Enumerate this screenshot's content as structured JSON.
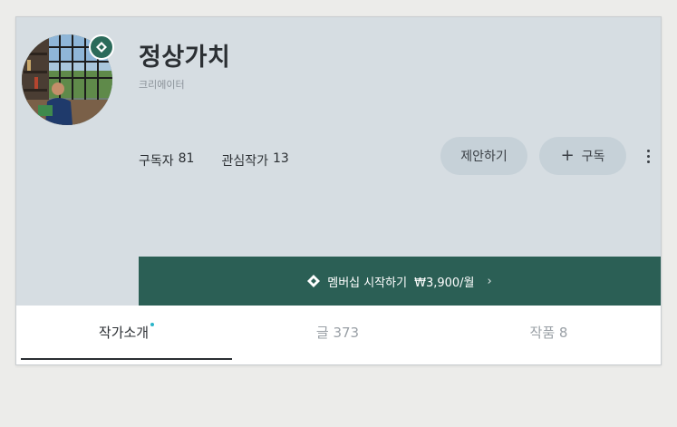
{
  "profile": {
    "name": "정상가치",
    "role": "크리에이터",
    "subscribers_label": "구독자",
    "subscribers_count": "81",
    "following_label": "관심작가",
    "following_count": "13"
  },
  "actions": {
    "propose_label": "제안하기",
    "subscribe_label": "구독",
    "more_icon": "more-vertical-icon"
  },
  "membership": {
    "label": "멤버십 시작하기",
    "price": "₩3,900/월",
    "chevron": "›"
  },
  "tabs": [
    {
      "label": "작가소개",
      "active": true
    },
    {
      "label": "글 373",
      "active": false
    },
    {
      "label": "작품 8",
      "active": false
    }
  ],
  "colors": {
    "header_bg": "#d6dde2",
    "membership_bg": "#2b5f55",
    "badge_bg": "#2b6a5a",
    "button_bg": "#c6d1d8",
    "new_dot": "#2bb5c9"
  }
}
